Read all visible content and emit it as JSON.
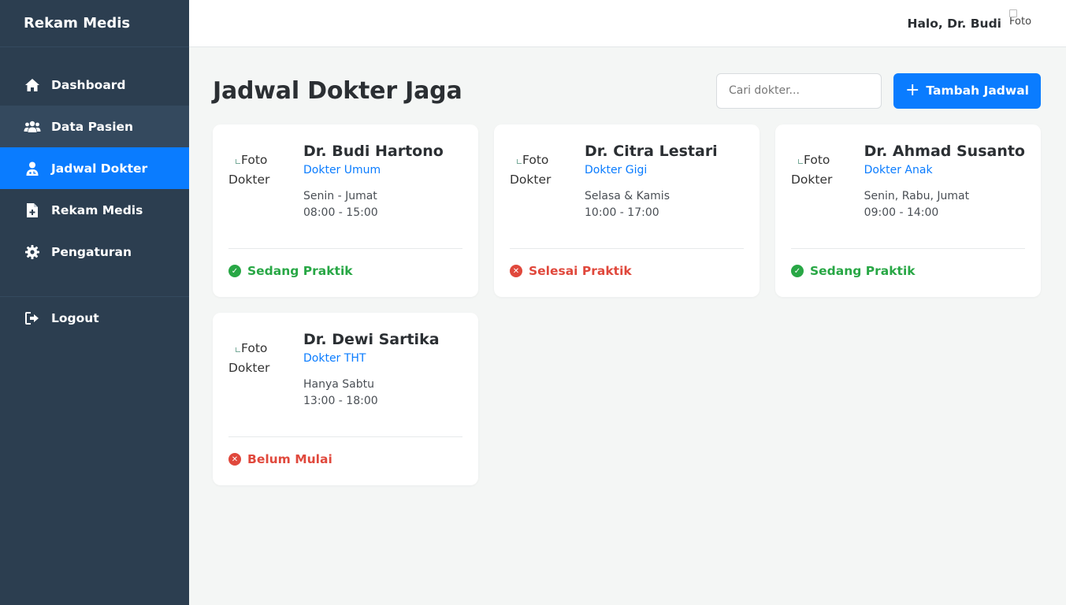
{
  "sidebar": {
    "brand": "Rekam Medis",
    "items": [
      {
        "label": "Dashboard",
        "icon": "home-icon"
      },
      {
        "label": "Data Pasien",
        "icon": "users-icon"
      },
      {
        "label": "Jadwal Dokter",
        "icon": "user-doctor-icon"
      },
      {
        "label": "Rekam Medis",
        "icon": "file-medical-icon"
      },
      {
        "label": "Pengaturan",
        "icon": "gear-icon"
      }
    ],
    "logout": "Logout"
  },
  "header": {
    "greeting": "Halo, Dr. Budi",
    "avatar_alt": "Foto"
  },
  "main": {
    "title": "Jadwal Dokter Jaga",
    "search_placeholder": "Cari dokter...",
    "add_button": "Tambah Jadwal"
  },
  "doctors": [
    {
      "photo_alt": "Foto Dokter",
      "name": "Dr. Budi Hartono",
      "specialty": "Dokter Umum",
      "days": "Senin - Jumat",
      "hours": "08:00 - 15:00",
      "status": "Sedang Praktik",
      "status_type": "active"
    },
    {
      "photo_alt": "Foto Dokter",
      "name": "Dr. Citra Lestari",
      "specialty": "Dokter Gigi",
      "days": "Selasa & Kamis",
      "hours": "10:00 - 17:00",
      "status": "Selesai Praktik",
      "status_type": "inactive"
    },
    {
      "photo_alt": "Foto Dokter",
      "name": "Dr. Ahmad Susanto",
      "specialty": "Dokter Anak",
      "days": "Senin, Rabu, Jumat",
      "hours": "09:00 - 14:00",
      "status": "Sedang Praktik",
      "status_type": "active"
    },
    {
      "photo_alt": "Foto Dokter",
      "name": "Dr. Dewi Sartika",
      "specialty": "Dokter THT",
      "days": "Hanya Sabtu",
      "hours": "13:00 - 18:00",
      "status": "Belum Mulai",
      "status_type": "inactive"
    }
  ],
  "colors": {
    "sidebar": "#2c3e50",
    "accent": "#0a7cff",
    "success": "#28a745",
    "danger": "#e0483c"
  }
}
